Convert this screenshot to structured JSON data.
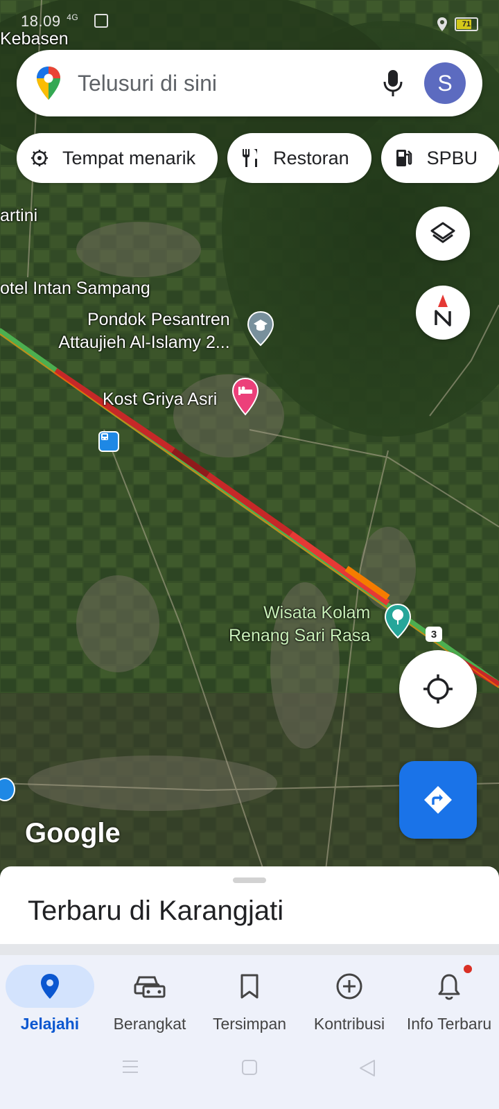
{
  "status_bar": {
    "time": "18.09",
    "signal": "4G",
    "battery": "71"
  },
  "search": {
    "placeholder": "Telusuri di sini",
    "avatar_initial": "S"
  },
  "chips": [
    {
      "label": "Tempat menarik",
      "icon": "attractions-icon"
    },
    {
      "label": "Restoran",
      "icon": "restaurant-icon"
    },
    {
      "label": "SPBU",
      "icon": "gas-station-icon"
    }
  ],
  "map": {
    "labels": {
      "kebasen": "Kebasen",
      "artini": "artini",
      "hotel": "otel Intan Sampang",
      "pondok_line1": "Pondok Pesantren",
      "pondok_line2": "Attaujieh Al-Islamy 2...",
      "kost": "Kost Griya Asri",
      "wisata_line1": "Wisata Kolam",
      "wisata_line2": "Renang Sari Rasa",
      "route_shield": "3"
    },
    "watermark": "Google"
  },
  "sheet": {
    "title": "Terbaru di Karangjati"
  },
  "bottom_nav": [
    {
      "label": "Jelajahi",
      "icon": "explore-pin-icon",
      "active": true
    },
    {
      "label": "Berangkat",
      "icon": "car-icon",
      "active": false
    },
    {
      "label": "Tersimpan",
      "icon": "bookmark-icon",
      "active": false
    },
    {
      "label": "Kontribusi",
      "icon": "add-circle-icon",
      "active": false
    },
    {
      "label": "Info Terbaru",
      "icon": "bell-icon",
      "active": false,
      "badge": true
    }
  ],
  "colors": {
    "accent": "#1a73e8",
    "traffic_red": "#c62828",
    "traffic_orange": "#f57c00",
    "traffic_green": "#4caf50",
    "avatar": "#5c6bc0"
  }
}
